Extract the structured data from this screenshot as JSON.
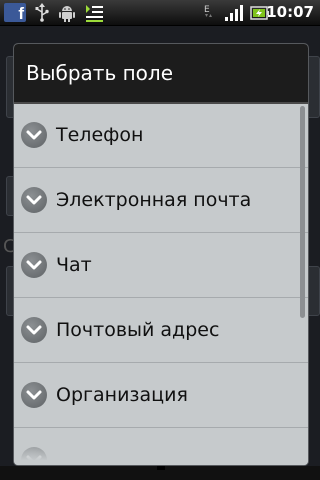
{
  "status_bar": {
    "facebook_icon": "facebook-icon",
    "facebook_glyph": "f",
    "usb_icon": "usb-icon",
    "android_icon": "android-debug-icon",
    "queue_icon": "download-queue-icon",
    "network_icon": "edge-network-icon",
    "network_letter": "E",
    "signal_icon": "signal-strength-icon",
    "battery_icon": "battery-charging-icon",
    "time": "10:07"
  },
  "dialog": {
    "title": "Выбрать поле",
    "items": [
      {
        "label": "Телефон",
        "icon": "chevron-down-icon"
      },
      {
        "label": "Электронная почта",
        "icon": "chevron-down-icon"
      },
      {
        "label": "Чат",
        "icon": "chevron-down-icon"
      },
      {
        "label": "Почтовый адрес",
        "icon": "chevron-down-icon"
      },
      {
        "label": "Организация",
        "icon": "chevron-down-icon"
      },
      {
        "label": "",
        "icon": "chevron-down-icon"
      }
    ]
  },
  "colors": {
    "dialog_background": "#c6cacc",
    "dialog_header": "#1c1c1c",
    "chevron_badge": "#6a6e71",
    "status_bar": "#1a1a1a",
    "facebook_blue": "#3b5998",
    "battery_green": "#7fc31c"
  },
  "background_hint": {
    "letter": "С"
  }
}
